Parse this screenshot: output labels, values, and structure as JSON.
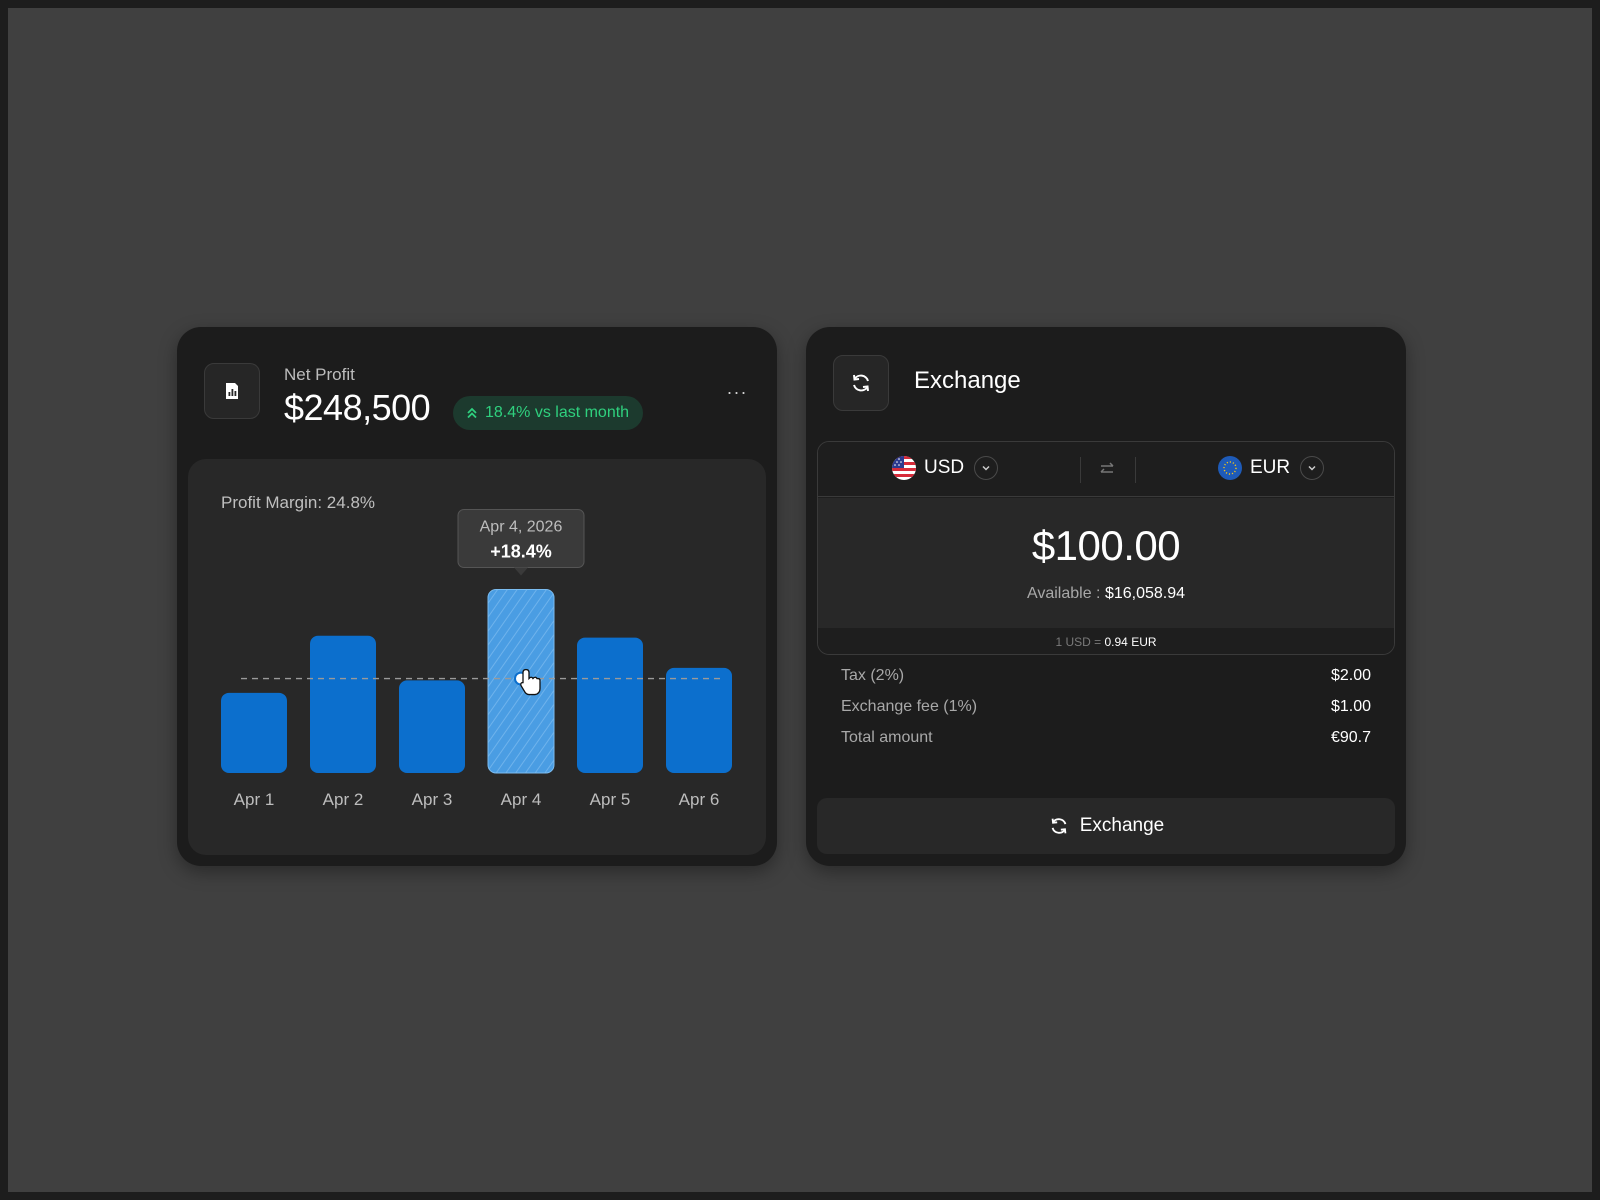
{
  "net_profit": {
    "label": "Net Profit",
    "value": "$248,500",
    "badge": "18.4% vs last month",
    "more": "···",
    "profit_margin": "Profit Margin: 24.8%",
    "tooltip": {
      "date": "Apr 4, 2026",
      "value": "+18.4%"
    },
    "accent_color": "#0c6fcd",
    "badge_color": "#2fd07e"
  },
  "chart_data": {
    "type": "bar",
    "categories": [
      "Apr 1",
      "Apr 2",
      "Apr 3",
      "Apr 4",
      "Apr 5",
      "Apr 6"
    ],
    "values": [
      45,
      77,
      52,
      103,
      76,
      59
    ],
    "highlighted": "Apr 4",
    "reference_line": 53,
    "ylim": [
      0,
      110
    ],
    "grid": false
  },
  "exchange": {
    "title": "Exchange",
    "from_currency": "USD",
    "to_currency": "EUR",
    "amount": "$100.00",
    "available_label": "Available :",
    "available_value": "$16,058.94",
    "rate_label": "1 USD =",
    "rate_value": "0.94 EUR",
    "fees": [
      {
        "label": "Tax (2%)",
        "value": "$2.00"
      },
      {
        "label": "Exchange fee (1%)",
        "value": "$1.00"
      },
      {
        "label": "Total amount",
        "value": "€90.7"
      }
    ],
    "button_label": "Exchange"
  }
}
